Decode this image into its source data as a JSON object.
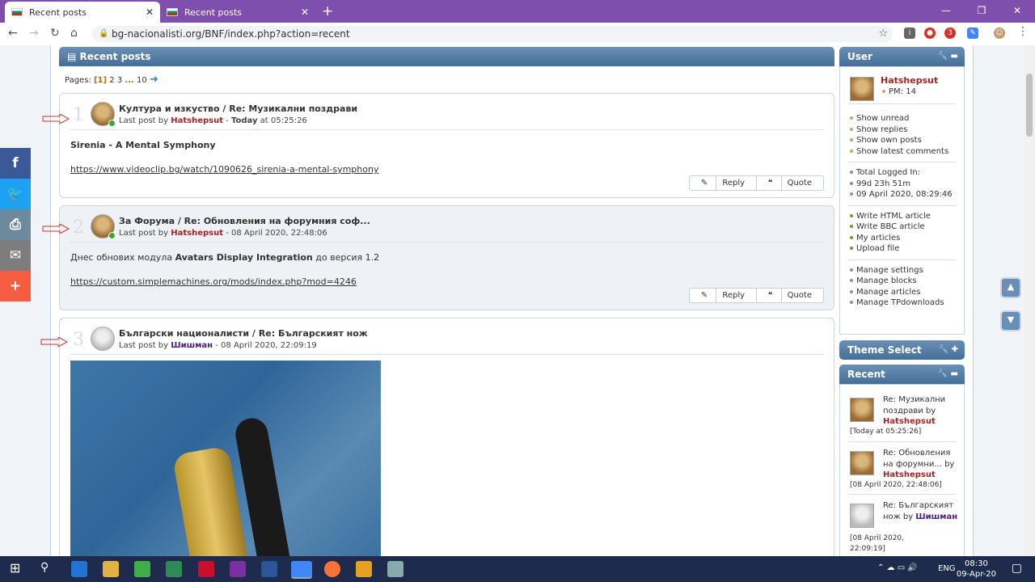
{
  "browser": {
    "tabs": [
      {
        "title": "Recent posts"
      },
      {
        "title": "Recent posts"
      }
    ],
    "url": "bg-nacionalisti.org/BNF/index.php?action=recent",
    "ext_badge": "3"
  },
  "header": {
    "title": "Recent posts"
  },
  "pagination": {
    "label": "Pages:",
    "current": "[1]",
    "p2": "2",
    "p3": "3",
    "ellipsis": "...",
    "last": "10"
  },
  "posts": [
    {
      "number": "1",
      "title": "Култура и изкуство / Re: Музикални поздрави",
      "by_label": "Last post by",
      "author": "Hatshepsut",
      "date_bold": "Today",
      "date_rest": "at 05:25:26",
      "body_title": "Sirenia  - A Mental Symphony",
      "body_link": "https://www.videoclip.bg/watch/1090626_sirenia-a-mental-symphony",
      "reply": "Reply",
      "quote": "Quote"
    },
    {
      "number": "2",
      "title": "За Форума / Re: Обновления на форумния соф...",
      "by_label": "Last post by",
      "author": "Hatshepsut",
      "date_rest": "- 08 April 2020, 22:48:06",
      "body_pre": "Днес обнових модула",
      "body_bold": "Avatars Display Integration",
      "body_post": "до версия 1.2",
      "body_link": "https://custom.simplemachines.org/mods/index.php?mod=4246",
      "reply": "Reply",
      "quote": "Quote"
    },
    {
      "number": "3",
      "title": "Български националисти / Re: Българският нож",
      "by_label": "Last post by",
      "author": "Шишман",
      "date_rest": "- 08 April 2020, 22:09:19"
    }
  ],
  "sidebar": {
    "user": {
      "title": "User",
      "name": "Hatshepsut",
      "pm": "PM: 14",
      "links": [
        "Show unread",
        "Show replies",
        "Show own posts",
        "Show latest comments"
      ],
      "stats": [
        "Total Logged In:",
        "99d 23h 51m",
        "09 April 2020, 08:29:46"
      ],
      "articles": [
        "Write HTML article",
        "Write BBC article",
        "My articles",
        "Upload file"
      ],
      "manage": [
        "Manage settings",
        "Manage blocks",
        "Manage articles",
        "Manage TPdownloads"
      ]
    },
    "theme": {
      "title": "Theme Select"
    },
    "recent": {
      "title": "Recent",
      "items": [
        {
          "text": "Re: Музикални поздрави by",
          "author": "Hatshepsut",
          "date": "[Today at 05:25:26]"
        },
        {
          "text": "Re: Обновления на форумни... by",
          "author": "Hatshepsut",
          "date": "[08 April 2020, 22:48:06]"
        },
        {
          "text": "Re: Българският нож by",
          "author": "Шишман",
          "date": "[08 April 2020, 22:09:19]"
        }
      ]
    }
  },
  "taskbar": {
    "lang": "ENG",
    "time": "08:30",
    "date": "09-Apr-20"
  },
  "colors": {
    "tabbar": "#7f4fae",
    "catbar": "#4a729c",
    "author": "#a32424",
    "author2": "#4d1e8a"
  }
}
